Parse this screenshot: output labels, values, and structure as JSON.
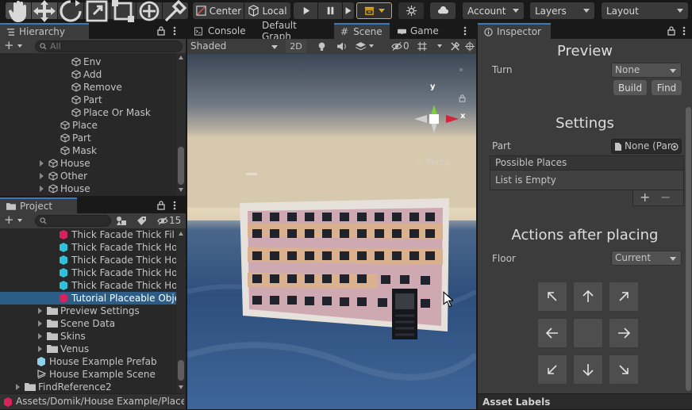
{
  "toolbar": {
    "center_label": "Center",
    "local_label": "Local",
    "account_label": "Account",
    "layers_label": "Layers",
    "layout_label": "Layout"
  },
  "hierarchy": {
    "tab": "Hierarchy",
    "search_placeholder": "All",
    "items": [
      {
        "label": "Env"
      },
      {
        "label": "Add"
      },
      {
        "label": "Remove"
      },
      {
        "label": "Part"
      },
      {
        "label": "Place Or Mask"
      },
      {
        "label": "Place"
      },
      {
        "label": "Part"
      },
      {
        "label": "Mask"
      },
      {
        "label": "House"
      },
      {
        "label": "Other"
      },
      {
        "label": "House"
      }
    ]
  },
  "project": {
    "tab": "Project",
    "hidden_count": "15",
    "items": [
      {
        "label": "Thick Facade Thick Fil"
      },
      {
        "label": "Thick Facade Thick Ho"
      },
      {
        "label": "Thick Facade Thick Ho"
      },
      {
        "label": "Thick Facade Thick Ho"
      },
      {
        "label": "Thick Facade Thick Ho"
      },
      {
        "label": "Tutorial Placeable Obje"
      },
      {
        "label": "Preview Settings"
      },
      {
        "label": "Scene Data"
      },
      {
        "label": "Skins"
      },
      {
        "label": "Venus"
      },
      {
        "label": "House Example Prefab"
      },
      {
        "label": "House Example Scene"
      },
      {
        "label": "FindReference2"
      }
    ],
    "path": "Assets/Domik/House Example/Placea"
  },
  "scene": {
    "tabs": [
      "Console",
      "Default Graph",
      "Scene",
      "Game"
    ],
    "shading": "Shaded",
    "mode_2d": "2D",
    "hidden_count": "0",
    "gizmo_y": "y",
    "gizmo_x": "x",
    "persp": "< Persp"
  },
  "inspector": {
    "tab": "Inspector",
    "preview_title": "Preview",
    "turn_label": "Turn",
    "turn_value": "None",
    "build_label": "Build",
    "find_label": "Find",
    "settings_title": "Settings",
    "part_label": "Part",
    "part_value": "None (Par",
    "list_header": "Possible Places",
    "list_empty": "List is Empty",
    "plus": "+",
    "minus": "−",
    "actions_title": "Actions after placing",
    "floor_label": "Floor",
    "floor_value": "Current",
    "asset_labels": "Asset Labels"
  }
}
